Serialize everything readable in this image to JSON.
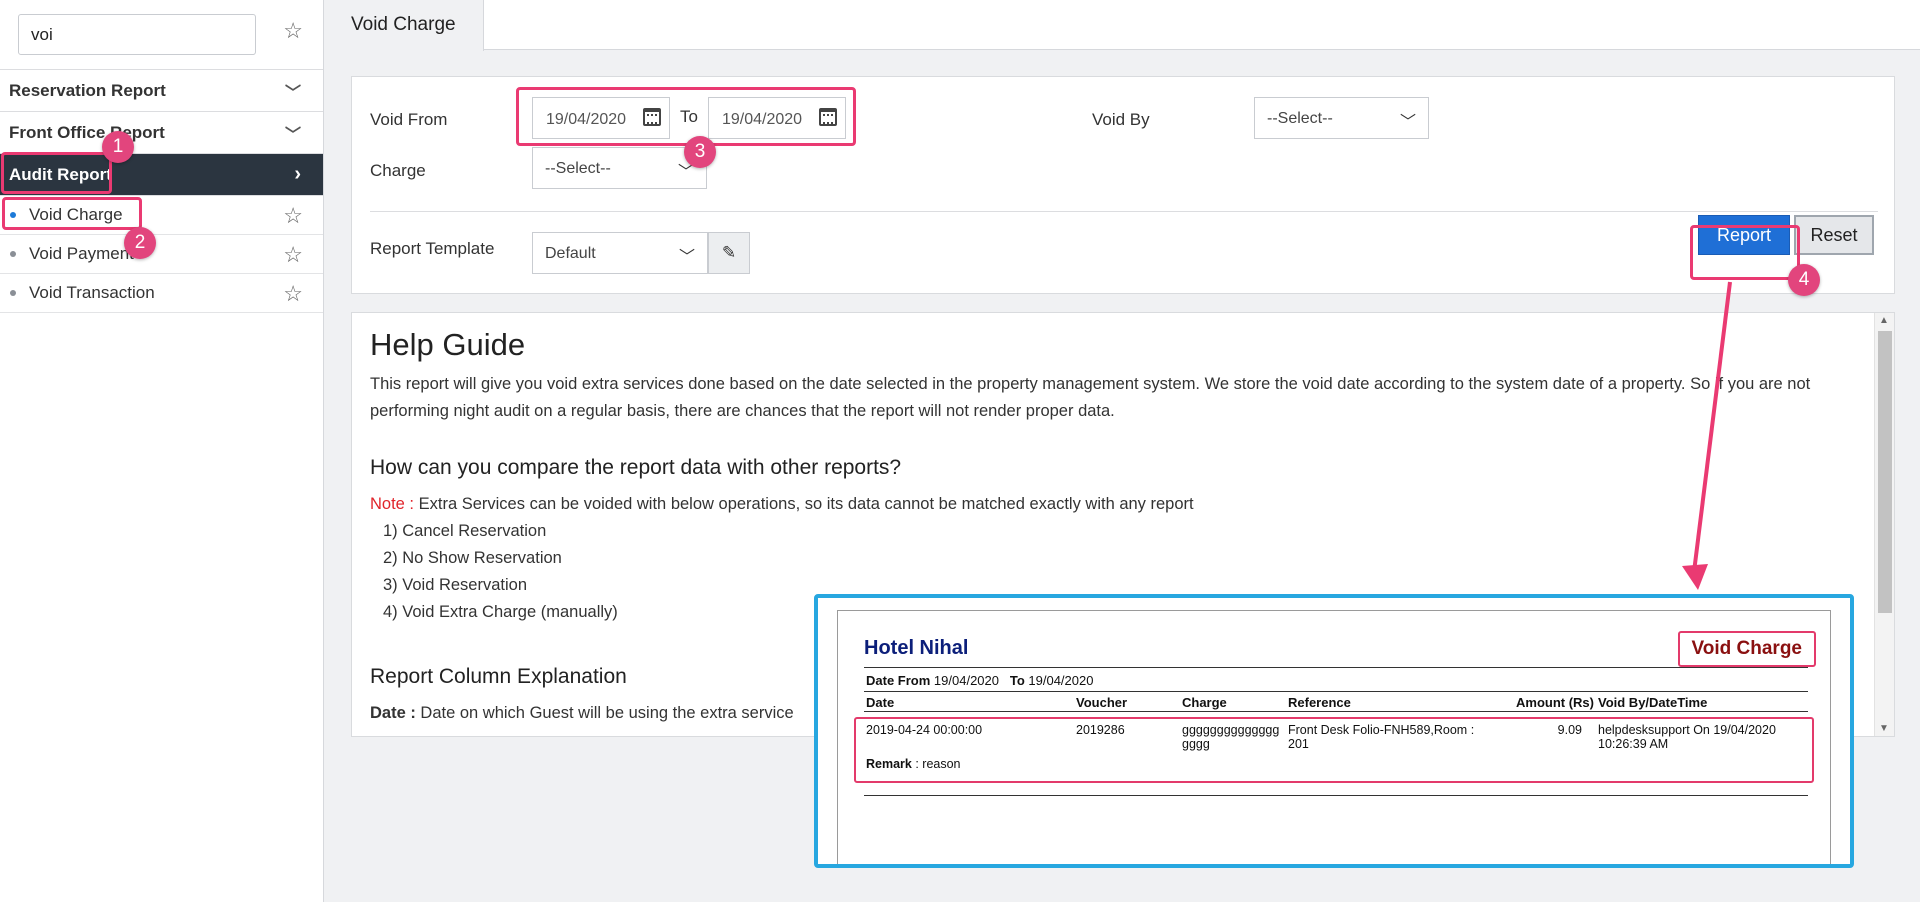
{
  "sidebar": {
    "search_value": "voi",
    "menus": [
      {
        "label": "Reservation Report"
      },
      {
        "label": "Front Office Report"
      },
      {
        "label": "Audit Report"
      }
    ],
    "items": [
      {
        "label": "Void Charge"
      },
      {
        "label": "Void Payment"
      },
      {
        "label": "Void Transaction"
      }
    ]
  },
  "tab": {
    "label": "Void Charge"
  },
  "filters": {
    "void_from_label": "Void From",
    "from_date": "19/04/2020",
    "to_label": "To",
    "to_date": "19/04/2020",
    "void_by_label": "Void By",
    "void_by_value": "--Select--",
    "charge_label": "Charge",
    "charge_value": "--Select--",
    "template_label": "Report Template",
    "template_value": "Default",
    "report_button": "Report",
    "reset_button": "Reset"
  },
  "help": {
    "title": "Help Guide",
    "intro": "This report will give you void extra services done based on the date selected in the property management system. We store the void date according to the system date of a property. So if you are not performing night audit on a regular basis, there are chances that the report will not render proper data.",
    "compare_heading": "How can you compare the report data with other reports?",
    "note_label": "Note :",
    "note_text": " Extra Services can be voided with below operations, so its data cannot be matched exactly with any report",
    "operations": [
      "1) Cancel Reservation",
      "2) No Show Reservation",
      "3) Void Reservation",
      "4) Void Extra Charge (manually)"
    ],
    "columns_heading": "Report Column Explanation",
    "date_label": "Date :",
    "date_text": " Date on which Guest will be using the extra service"
  },
  "annotations": {
    "badges": [
      "1",
      "2",
      "3",
      "4"
    ],
    "highlight_color": "#ea3a72",
    "preview_border_color": "#27a7e0"
  },
  "preview": {
    "hotel_name": "Hotel Nihal",
    "report_title": "Void Charge",
    "date_from_label": "Date From",
    "date_from": "19/04/2020",
    "to_label": "To",
    "date_to": "19/04/2020",
    "headers": [
      "Date",
      "Voucher",
      "Charge",
      "Reference",
      "Amount (Rs)",
      "Void By/DateTime"
    ],
    "row": {
      "date": "2019-04-24 00:00:00",
      "voucher": "2019286",
      "charge_line1": "gggggggggggggg",
      "charge_line2": "gggg",
      "reference_line1": "Front Desk Folio-FNH589,Room :",
      "reference_line2": "201",
      "amount": "9.09",
      "void_by_line1": "helpdesksupport On 19/04/2020",
      "void_by_line2": "10:26:39 AM",
      "remark_label": "Remark",
      "remark_text": " : reason"
    }
  }
}
